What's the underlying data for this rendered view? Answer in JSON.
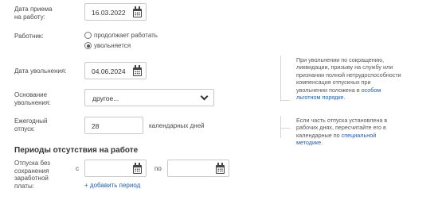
{
  "hire_date": {
    "label_line1": "Дата приема",
    "label_line2": "на работу:",
    "value": "16.03.2022"
  },
  "employee": {
    "label": "Работник:",
    "options": [
      {
        "label": "продолжает работать",
        "selected": false
      },
      {
        "label": "увольняется",
        "selected": true
      }
    ]
  },
  "dismissal_date": {
    "label": "Дата увольнения:",
    "value": "04.06.2024"
  },
  "dismissal_reason": {
    "label_line1": "Основание",
    "label_line2": "увольнения:",
    "value": "другое..."
  },
  "annual_leave": {
    "label_line1": "Ежегодный",
    "label_line2": "отпуск:",
    "value": "28",
    "unit": "календарных дней"
  },
  "hint_dismissal": {
    "lines": [
      "При увольнении по сокращению,",
      "ликвидации, призыву на службу или",
      "признании полной нетрудоспособности",
      "компенсация отпускных при",
      "увольнении положена в "
    ],
    "link_part1": "особом",
    "link_part2": "льготном порядке",
    "end": "."
  },
  "hint_leave": {
    "lines": [
      "Если часть отпуска установлена в",
      "рабочих днях, пересчитайте его в",
      "календарные по "
    ],
    "link_part1": "специальной",
    "link_part2": "методике",
    "end": "."
  },
  "absence": {
    "heading": "Периоды отсутствия на работе",
    "unpaid_label_lines": [
      "Отпуска без",
      "сохранения",
      "заработной",
      "платы:"
    ],
    "from_label": "с",
    "to_label": "по",
    "add_period": "+ добавить период"
  }
}
